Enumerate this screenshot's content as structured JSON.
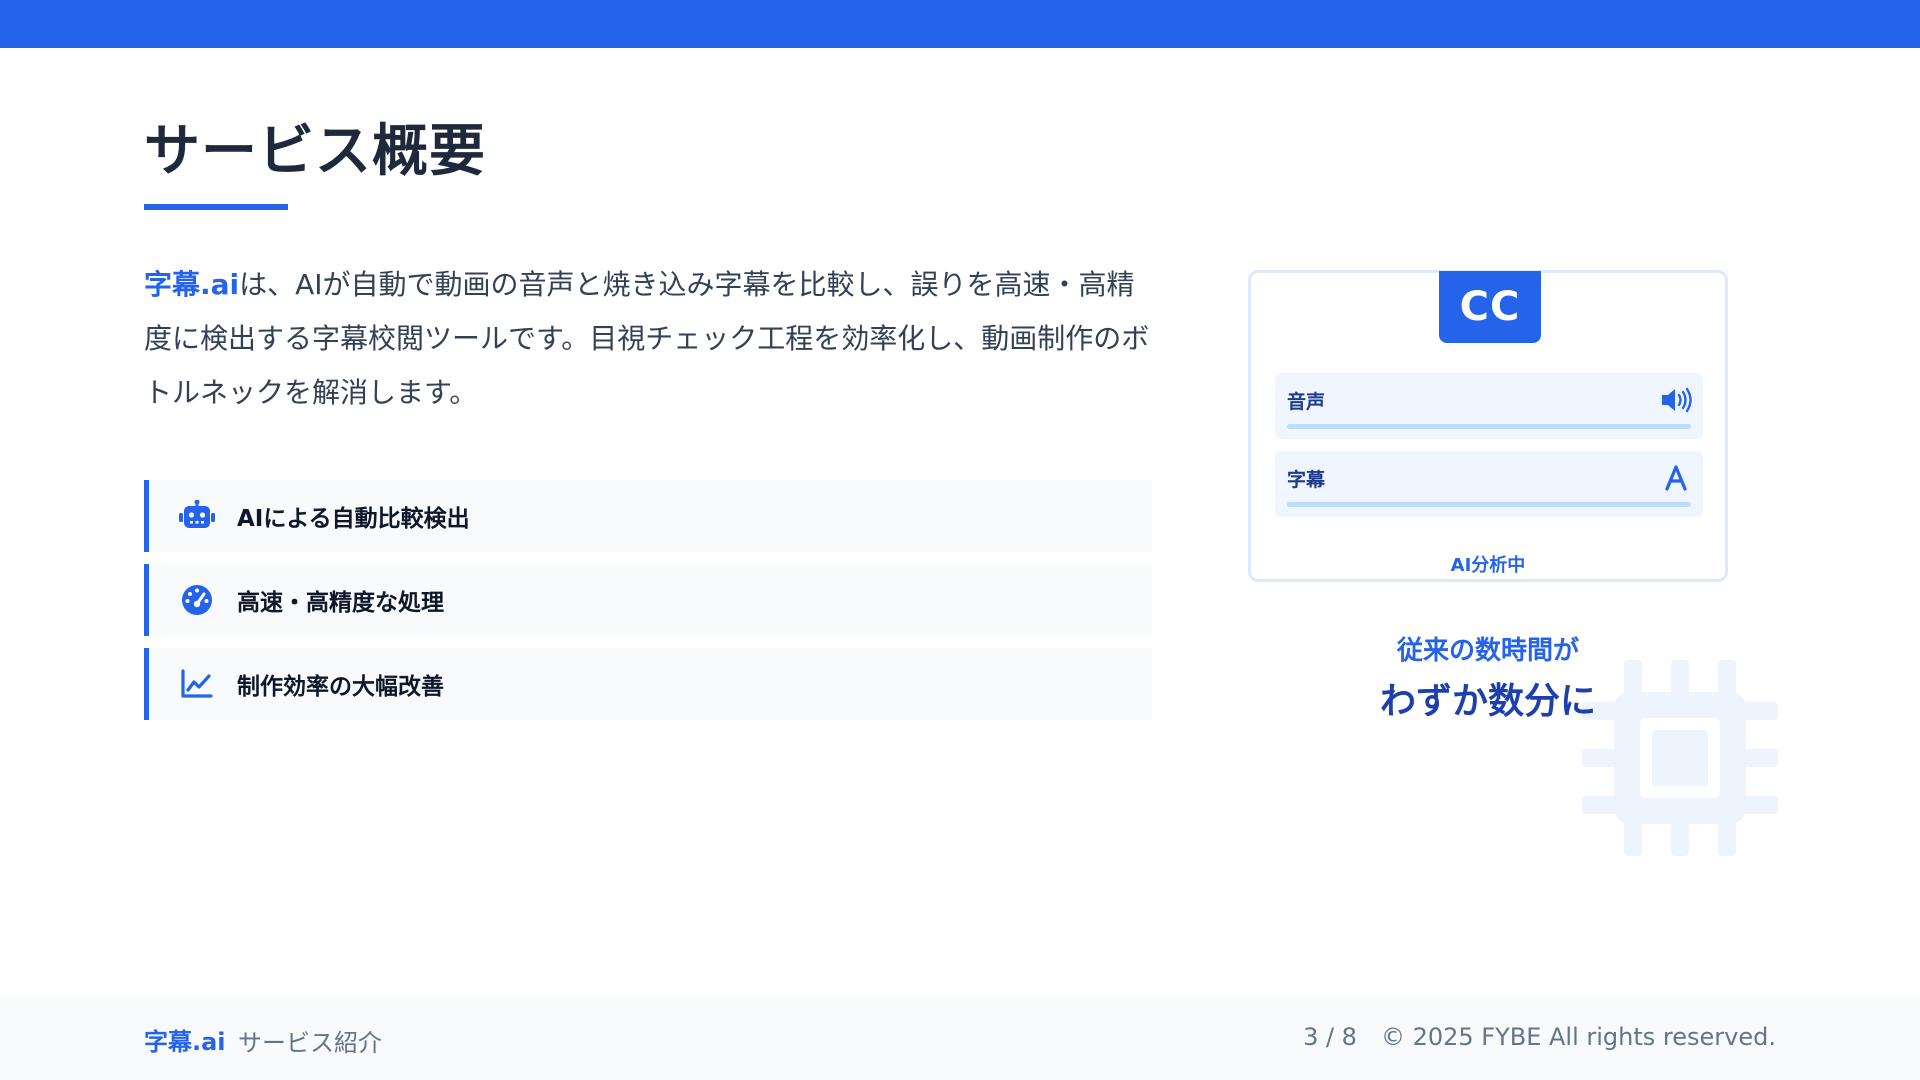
{
  "slide": {
    "title": "サービス概要",
    "intro": {
      "brand": "字幕.ai",
      "text": "は、AIが自動で動画の音声と焼き込み字幕を比較し、誤りを高速・高精度に検出する字幕校閲ツールです。目視チェック工程を効率化し、動画制作のボトルネックを解消します。"
    },
    "features": [
      {
        "icon": "robot-icon",
        "label": "AIによる自動比較検出"
      },
      {
        "icon": "speedometer-icon",
        "label": "高速・高精度な処理"
      },
      {
        "icon": "line-chart-icon",
        "label": "制作効率の大幅改善"
      }
    ]
  },
  "card": {
    "badge": "CC",
    "tracks": [
      {
        "label": "音声",
        "icon": "speaker-icon"
      },
      {
        "label": "字幕",
        "icon": "font-letter-icon"
      }
    ],
    "status": "AI分析中"
  },
  "callout": {
    "line1": "従来の数時間が",
    "line2": "わずか数分に"
  },
  "footer": {
    "brand": "字幕.ai",
    "subtitle": "サービス紹介",
    "page": "3 / 8",
    "copyright": "© 2025 FYBE All rights reserved."
  },
  "colors": {
    "accent": "#2563eb",
    "dark": "#1e293b"
  }
}
